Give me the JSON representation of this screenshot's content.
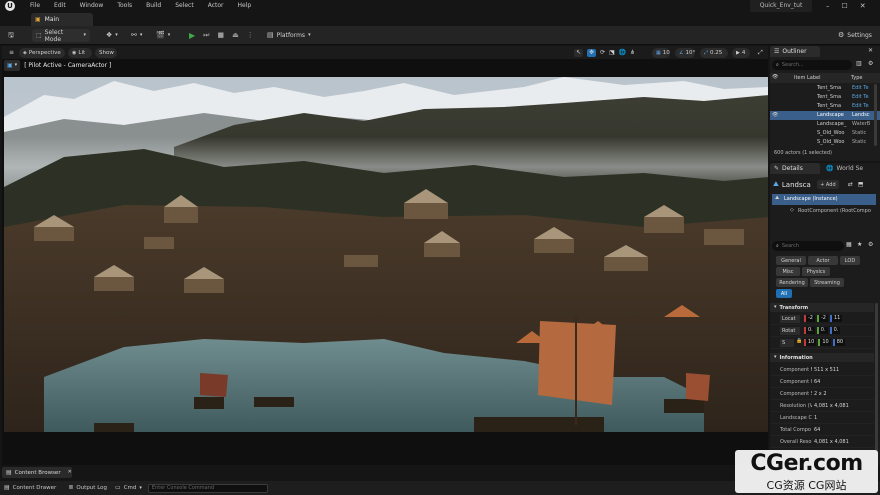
{
  "window": {
    "title": "Quick_Env_tut",
    "menu": [
      "File",
      "Edit",
      "Window",
      "Tools",
      "Build",
      "Select",
      "Actor",
      "Help"
    ],
    "tab": "Main"
  },
  "toolbar": {
    "select_mode": "Select Mode",
    "platforms": "Platforms",
    "settings": "Settings"
  },
  "viewport": {
    "perspective": "Perspective",
    "lit": "Lit",
    "show": "Show",
    "pilot": "[ Pilot Active - CameraActor ]",
    "grid_snap": "10",
    "rot_snap": "10°",
    "scale_snap": "0.25",
    "cam_speed": "4"
  },
  "outliner": {
    "title": "Outliner",
    "search_placeholder": "Search...",
    "col_label": "Item Label",
    "col_type": "Type",
    "rows": [
      {
        "label": "Tent_Sma",
        "type": "Edit Te"
      },
      {
        "label": "Tent_Sma",
        "type": "Edit Te"
      },
      {
        "label": "Tent_Sma",
        "type": "Edit Te"
      },
      {
        "label": "Landscape",
        "type": "Landsc"
      },
      {
        "label": "Landscape_",
        "type": "WaterB"
      },
      {
        "label": "S_Old_Woo",
        "type": "Static"
      },
      {
        "label": "S_Old_Woo",
        "type": "Static"
      }
    ],
    "summary": "600 actors (1 selected)"
  },
  "details": {
    "tab_details": "Details",
    "tab_world": "World Se",
    "object_name": "Landsca",
    "add_label": "+ Add",
    "instance": "Landscape (Instance)",
    "root_component": "RootComponent (RootCompo",
    "search_placeholder": "Search",
    "filters": [
      "General",
      "Actor",
      "LOD",
      "Misc",
      "Physics",
      "Rendering",
      "Streaming",
      "All"
    ],
    "transform": {
      "header": "Transform",
      "location": {
        "label": "Locat",
        "x": "-2",
        "y": "-2",
        "z": "11"
      },
      "rotation": {
        "label": "Rotat",
        "x": "0.",
        "y": "0.",
        "z": "0."
      },
      "scale": {
        "label": "S",
        "x": "10",
        "y": "10",
        "z": "80"
      }
    },
    "information": {
      "header": "Information",
      "rows": [
        {
          "label": "Component F",
          "value": "511 x 511"
        },
        {
          "label": "Component Q",
          "value": "64"
        },
        {
          "label": "Component S",
          "value": "2 x 2"
        },
        {
          "label": "Resolution (V",
          "value": "4,081 x 4,081"
        },
        {
          "label": "Landscape C",
          "value": "1"
        },
        {
          "label": "Total Compo",
          "value": "64"
        },
        {
          "label": "Overall Resol",
          "value": "4,081 x 4,081"
        }
      ]
    }
  },
  "bottom": {
    "content_browser": "Content Browser",
    "content_drawer": "Content Drawer",
    "output_log": "Output Log",
    "cmd": "Cmd",
    "console_placeholder": "Enter Console Command"
  },
  "watermark": {
    "top": "CGer.com",
    "bottom": "CG资源 CG网站"
  },
  "colors": {
    "accent_blue": "#1f6fb2",
    "selection": "#3a5f8a",
    "x_axis": "#c33b3b",
    "y_axis": "#5aa33b",
    "z_axis": "#3f6fc7",
    "play_green": "#3ea84a"
  }
}
